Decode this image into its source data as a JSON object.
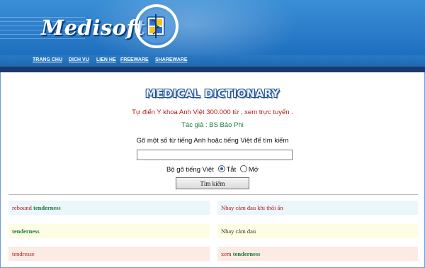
{
  "header": {
    "logo_text": "Medisoft",
    "logo_icon": "caduceus-shield-icon"
  },
  "nav": {
    "items": [
      "TRANG CHU",
      "DICH VU",
      "LIEN HE",
      "FREEWARE",
      "SHAREWARE"
    ]
  },
  "main": {
    "dict_title": "MEDICAL DICTIONARY",
    "subtitle": "Tự điển Y khoa Anh Việt  300.000 từ , xem trực tuyến .",
    "author": "Tác giả : BS Bảo Phi",
    "prompt": "Gõ một số từ tiếng Anh hoặc tiếng Việt để tìm kiếm",
    "search_value": "",
    "ime_label": "Bộ gõ tiếng Việt",
    "ime_off_label": "Tắt",
    "ime_on_label": "Mở",
    "ime_selected": "Tắt",
    "search_button": "Tìm kiếm"
  },
  "results": [
    {
      "en": [
        "rebound",
        "tenderness"
      ],
      "vi": [
        "Nhay cảm đau khi thôi ấn"
      ]
    },
    {
      "en": [
        "tenderness"
      ],
      "vi": [
        "Nhay cảm đau"
      ]
    },
    {
      "en": [
        "tendresse"
      ],
      "vi": [
        "xem",
        "tenderness"
      ]
    }
  ],
  "colors": {
    "header_blue": "#2f80cc",
    "nav_dark": "#1b3a6b",
    "title_red": "#b01a1a",
    "author_green": "#1e7a40",
    "row1_bg": "#eaf5fc",
    "row2_bg": "#fdfde4",
    "row3_bg": "#fbebe2"
  }
}
